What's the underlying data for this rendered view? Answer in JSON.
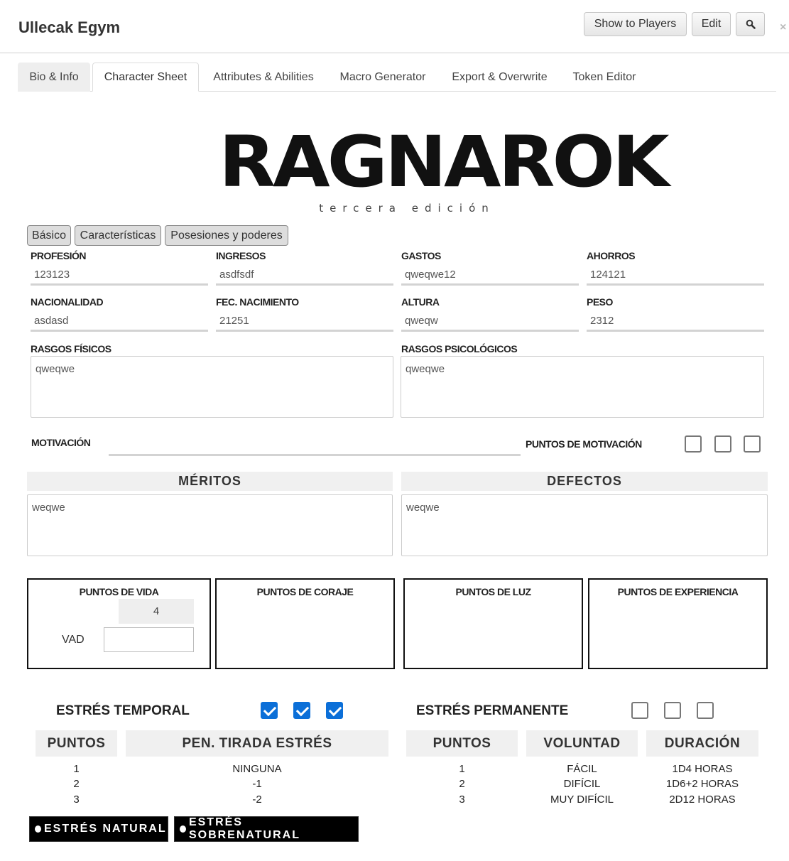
{
  "dialog": {
    "title": "Ullecak Egym",
    "buttons": {
      "show_to_players": "Show to Players",
      "edit": "Edit",
      "search_icon": "magnifier-icon"
    },
    "close": "×"
  },
  "tabs": [
    "Bio & Info",
    "Character Sheet",
    "Attributes & Abilities",
    "Macro Generator",
    "Export & Overwrite",
    "Token Editor"
  ],
  "logo": {
    "word": "RAGNAROK",
    "subtitle": "tercera edición"
  },
  "sections": [
    "Básico",
    "Características",
    "Posesiones y poderes"
  ],
  "basic": {
    "profesion": {
      "label": "PROFESIÓN",
      "value": "123123"
    },
    "ingresos": {
      "label": "INGRESOS",
      "value": "asdfsdf"
    },
    "gastos": {
      "label": "GASTOS",
      "value": "qweqwe12"
    },
    "ahorros": {
      "label": "AHORROS",
      "value": "124121"
    },
    "nacionalidad": {
      "label": "NACIONALIDAD",
      "value": "asdasd"
    },
    "fec_nacimiento": {
      "label": "FEC. NACIMIENTO",
      "value": "21251"
    },
    "altura": {
      "label": "ALTURA",
      "value": "qweqw"
    },
    "peso": {
      "label": "PESO",
      "value": "2312"
    },
    "rasgos_fisicos": {
      "label": "RASGOS FÍSICOS",
      "value": "qweqwe"
    },
    "rasgos_psicologicos": {
      "label": "RASGOS PSICOLÓGICOS",
      "value": "qweqwe"
    },
    "motivacion": {
      "label": "MOTIVACIÓN",
      "value": ""
    },
    "puntos_motivacion": {
      "label": "PUNTOS DE MOTIVACIÓN",
      "checks": [
        false,
        false,
        false
      ]
    }
  },
  "meritos": {
    "label": "MÉRITOS",
    "value": "weqwe"
  },
  "defectos": {
    "label": "DEFECTOS",
    "value": "weqwe"
  },
  "points": {
    "vida": {
      "label": "PUNTOS DE VIDA",
      "value": "4",
      "vad_label": "VAD",
      "vad_value": ""
    },
    "coraje": {
      "label": "PUNTOS DE CORAJE"
    },
    "luz": {
      "label": "PUNTOS DE LUZ"
    },
    "experiencia": {
      "label": "PUNTOS DE EXPERIENCIA"
    }
  },
  "stress": {
    "temporal": {
      "label": "ESTRÉS TEMPORAL",
      "checks": [
        true,
        true,
        true
      ],
      "headers": [
        "PUNTOS",
        "PEN. TIRADA ESTRÉS"
      ],
      "rows": [
        [
          "1",
          "NINGUNA"
        ],
        [
          "2",
          "-1"
        ],
        [
          "3",
          "-2"
        ]
      ]
    },
    "permanente": {
      "label": "ESTRÉS PERMANENTE",
      "checks": [
        false,
        false,
        false
      ],
      "headers": [
        "PUNTOS",
        "VOLUNTAD",
        "DURACIÓN"
      ],
      "rows": [
        [
          "1",
          "FÁCIL",
          "1D4 HORAS"
        ],
        [
          "2",
          "DIFÍCIL",
          "1D6+2 HORAS"
        ],
        [
          "3",
          "MUY DIFÍCIL",
          "2D12 HORAS"
        ]
      ]
    },
    "buttons": [
      "ESTRÉS NATURAL",
      "ESTRÉS SOBRENATURAL"
    ]
  },
  "colors": {
    "checkbox_checked": "#0b6fd8",
    "black_button": "#000000"
  }
}
